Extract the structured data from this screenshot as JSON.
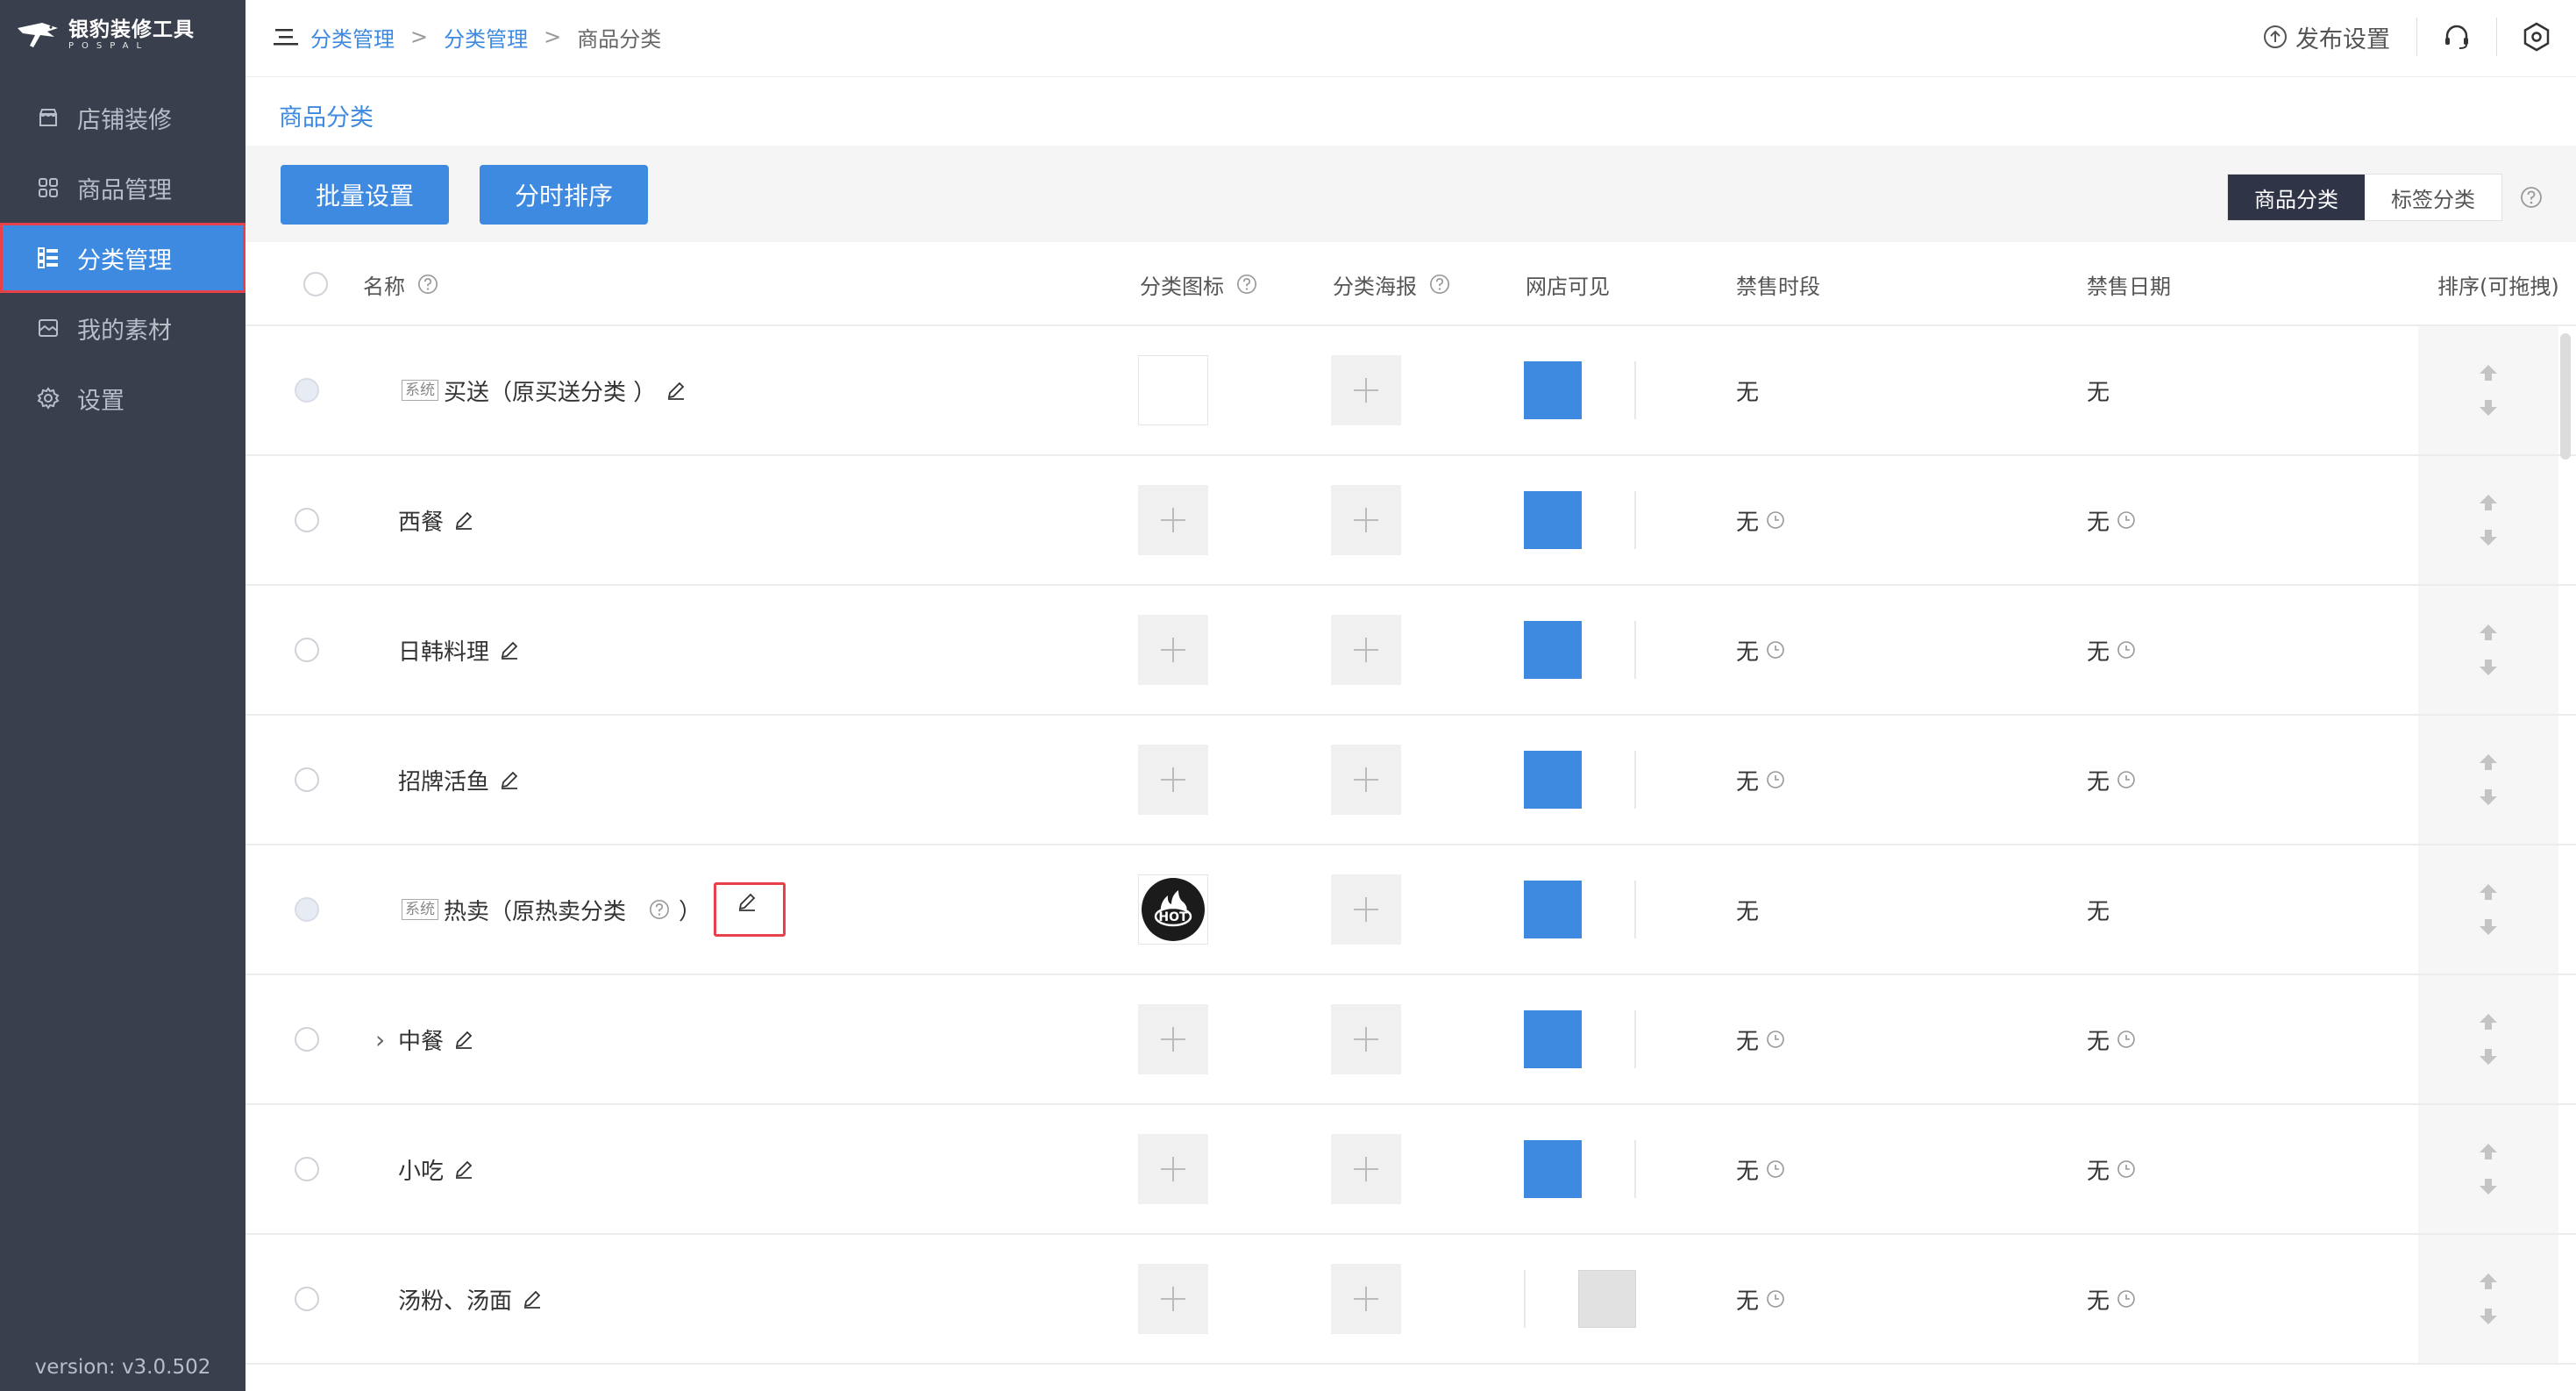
{
  "app": {
    "logo_title": "银豹装修工具",
    "logo_sub": "POSPAL",
    "version": "version: v3.0.502"
  },
  "sidebar": {
    "items": [
      {
        "label": "店铺装修",
        "icon": "store-icon"
      },
      {
        "label": "商品管理",
        "icon": "grid-icon"
      },
      {
        "label": "分类管理",
        "icon": "list-icon",
        "active": true
      },
      {
        "label": "我的素材",
        "icon": "image-icon"
      },
      {
        "label": "设置",
        "icon": "gear-icon"
      }
    ]
  },
  "header": {
    "breadcrumb": [
      "分类管理",
      "分类管理",
      "商品分类"
    ],
    "separator": ">",
    "publish_label": "发布设置"
  },
  "page": {
    "section_title": "商品分类",
    "batch_button": "批量设置",
    "timesort_button": "分时排序",
    "toggle": [
      "商品分类",
      "标签分类"
    ],
    "toggle_active": "商品分类"
  },
  "table": {
    "headers": {
      "name": "名称",
      "icon": "分类图标",
      "poster": "分类海报",
      "visible": "网店可见",
      "period": "禁售时段",
      "date": "禁售日期",
      "sort": "排序(可拖拽)"
    },
    "rows": [
      {
        "name": "买送（原买送分类 ）",
        "system": true,
        "sys_label": "系统",
        "icon": "blank",
        "visible": true,
        "period": "无",
        "date": "无",
        "clock": false
      },
      {
        "name": "西餐",
        "system": false,
        "icon": "upload",
        "visible": true,
        "period": "无",
        "date": "无",
        "clock": true
      },
      {
        "name": "日韩料理",
        "system": false,
        "icon": "upload",
        "visible": true,
        "period": "无",
        "date": "无",
        "clock": true
      },
      {
        "name": "招牌活鱼",
        "system": false,
        "icon": "upload",
        "visible": true,
        "period": "无",
        "date": "无",
        "clock": true
      },
      {
        "name": "热卖（原热卖分类",
        "name_suffix": "）",
        "system": true,
        "sys_label": "系统",
        "icon": "hot",
        "hot_text": "HOT",
        "visible": true,
        "period": "无",
        "date": "无",
        "clock": false,
        "highlight_edit": true
      },
      {
        "name": "中餐",
        "system": false,
        "expandable": true,
        "icon": "upload",
        "visible": true,
        "period": "无",
        "date": "无",
        "clock": true
      },
      {
        "name": "小吃",
        "system": false,
        "icon": "upload",
        "visible": true,
        "period": "无",
        "date": "无",
        "clock": true
      },
      {
        "name": "汤粉、汤面",
        "system": false,
        "icon": "upload",
        "visible": false,
        "period": "无",
        "date": "无",
        "clock": true
      }
    ]
  },
  "colors": {
    "sidebar_bg": "#3a3f4d",
    "accent": "#3d8ae0",
    "highlight_border": "#e8414a",
    "toggle_active_bg": "#2f3547"
  }
}
